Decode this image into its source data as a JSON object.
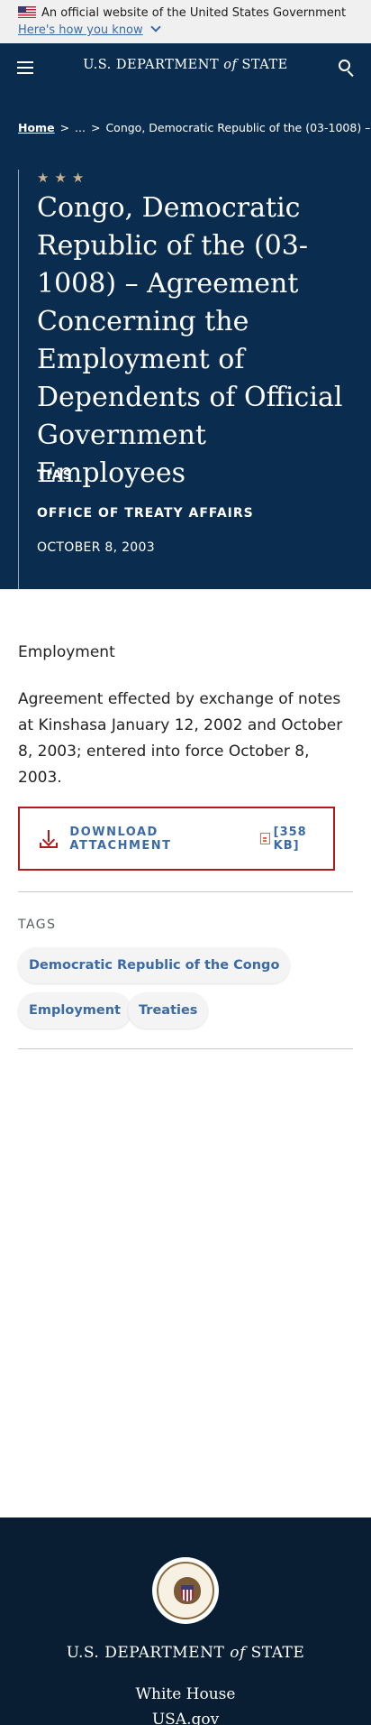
{
  "gov_banner": {
    "text": "An official website of the United States Government",
    "link_text": "Here's how you know"
  },
  "header": {
    "brand_pre": "U.S. DEPARTMENT",
    "brand_of": "of",
    "brand_post": "STATE",
    "menu_icon": "hamburger-icon",
    "search_icon": "search-icon"
  },
  "breadcrumb": {
    "home": "Home",
    "separator": ">",
    "ellipsis": "...",
    "current": "Congo, Democratic Republic of the (03-1008) – ..."
  },
  "hero": {
    "stars": "★★★",
    "title": "Congo, Democratic Republic of the (03-1008) – Agreement Concerning the Employment of Dependents of Official Government Employees",
    "series": "TIAS",
    "office": "OFFICE OF TREATY AFFAIRS",
    "date": "OCTOBER 8, 2003"
  },
  "main": {
    "category": "Employment",
    "summary": "Agreement effected by exchange of notes at Kinshasa January 12, 2002 and October 8, 2003; entered into force October 8, 2003.",
    "download_label": "DOWNLOAD ATTACHMENT",
    "download_size": "[358 KB]",
    "tags_heading": "TAGS",
    "tags": [
      "Democratic Republic of the Congo",
      "Employment",
      "Treaties"
    ]
  },
  "footer": {
    "brand_pre": "U.S. DEPARTMENT",
    "brand_of": "of",
    "brand_post": "STATE",
    "links": [
      "White House",
      "USA.gov"
    ]
  },
  "colors": {
    "navy": "#0a2d4f",
    "footer_navy": "#091e33",
    "link_blue": "#3b6aa5",
    "accent_red": "#b31b1b",
    "star_gold": "#c7b08b"
  }
}
